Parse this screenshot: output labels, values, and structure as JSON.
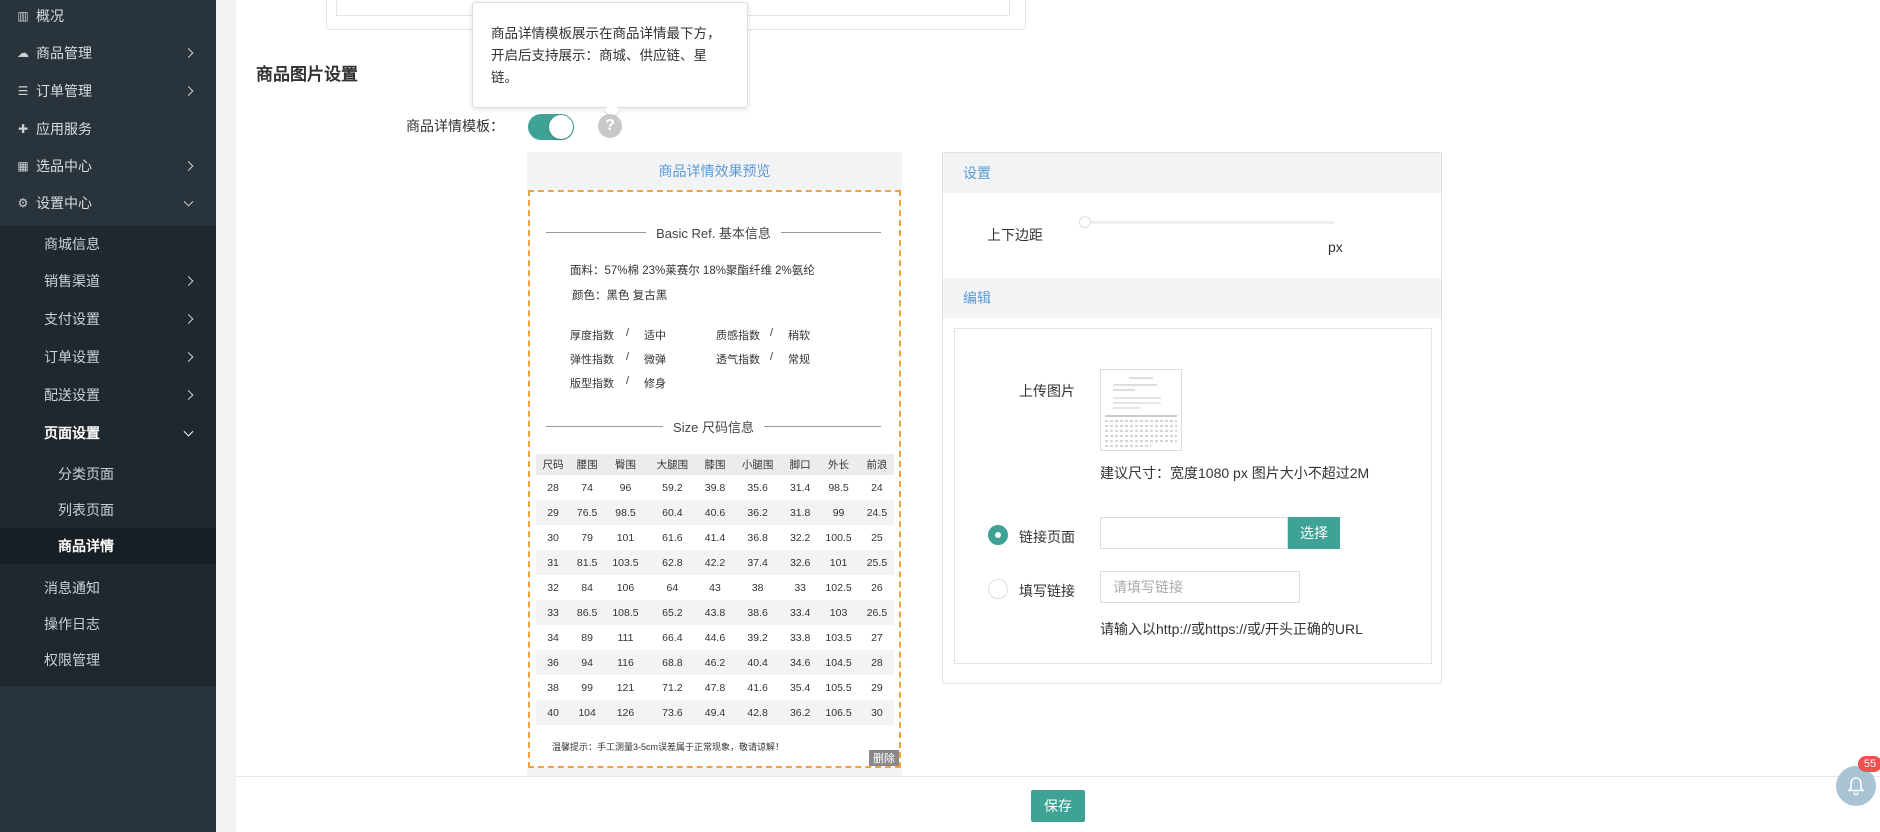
{
  "sidebar": {
    "items": [
      {
        "label": "概况",
        "icon": "book-icon"
      },
      {
        "label": "商品管理",
        "icon": "cloud-icon"
      },
      {
        "label": "订单管理",
        "icon": "list-icon"
      },
      {
        "label": "应用服务",
        "icon": "puzzle-icon"
      },
      {
        "label": "选品中心",
        "icon": "table-icon"
      },
      {
        "label": "设置中心",
        "icon": "gear-icon"
      }
    ],
    "sub_items": [
      "商城信息",
      "销售渠道",
      "支付设置",
      "订单设置",
      "配送设置",
      "页面设置",
      "消息通知",
      "操作日志",
      "权限管理"
    ],
    "page_sub_items": [
      "分类页面",
      "列表页面",
      "商品详情"
    ]
  },
  "section_title": "商品图片设置",
  "tooltip_text": "商品详情模板展示在商品详情最下方，开启后支持展示：商城、供应链、星链。",
  "template_label": "商品详情模板：",
  "template_enabled": true,
  "help_glyph": "?",
  "preview": {
    "header": "商品详情效果预览",
    "basic_title": "Basic Ref.  基本信息",
    "fabric": "面料：57%棉 23%莱赛尔 18%聚酯纤维 2%氨纶",
    "color": "颜色：黑色 复古黑",
    "indices": [
      {
        "name": "厚度指数",
        "value": "适中"
      },
      {
        "name": "质感指数",
        "value": "稍软"
      },
      {
        "name": "弹性指数",
        "value": "微弹"
      },
      {
        "name": "透气指数",
        "value": "常规"
      },
      {
        "name": "版型指数",
        "value": "修身"
      }
    ],
    "separator": "/",
    "size_title": "Size  尺码信息",
    "size_headers": [
      "尺码",
      "腰围",
      "臀围",
      "大腿围",
      "膝围",
      "小腿围",
      "脚口",
      "外长",
      "前浪"
    ],
    "size_rows": [
      [
        "28",
        "74",
        "96",
        "59.2",
        "39.8",
        "35.6",
        "31.4",
        "98.5",
        "24"
      ],
      [
        "29",
        "76.5",
        "98.5",
        "60.4",
        "40.6",
        "36.2",
        "31.8",
        "99",
        "24.5"
      ],
      [
        "30",
        "79",
        "101",
        "61.6",
        "41.4",
        "36.8",
        "32.2",
        "100.5",
        "25"
      ],
      [
        "31",
        "81.5",
        "103.5",
        "62.8",
        "42.2",
        "37.4",
        "32.6",
        "101",
        "25.5"
      ],
      [
        "32",
        "84",
        "106",
        "64",
        "43",
        "38",
        "33",
        "102.5",
        "26"
      ],
      [
        "33",
        "86.5",
        "108.5",
        "65.2",
        "43.8",
        "38.6",
        "33.4",
        "103",
        "26.5"
      ],
      [
        "34",
        "89",
        "111",
        "66.4",
        "44.6",
        "39.2",
        "33.8",
        "103.5",
        "27"
      ],
      [
        "36",
        "94",
        "116",
        "68.8",
        "46.2",
        "40.4",
        "34.6",
        "104.5",
        "28"
      ],
      [
        "38",
        "99",
        "121",
        "71.2",
        "47.8",
        "41.6",
        "35.4",
        "105.5",
        "29"
      ],
      [
        "40",
        "104",
        "126",
        "73.6",
        "49.4",
        "42.8",
        "36.2",
        "106.5",
        "30"
      ]
    ],
    "note": "温馨提示：手工测量3-5cm误差属于正常现象，敬请谅解！",
    "delete_label": "删除"
  },
  "settings": {
    "header": "设置",
    "margin_label": "上下边距",
    "margin_unit": "px",
    "edit_header": "编辑",
    "upload_label": "上传图片",
    "size_hint": "建议尺寸：宽度1080 px 图片大小不超过2M",
    "link_page_label": "链接页面",
    "link_page_selected": true,
    "link_page_value": "",
    "choose_button": "选择",
    "custom_link_label": "填写链接",
    "custom_link_placeholder": "请填写链接",
    "url_hint": "请输入以http://或https://或/开头正确的URL"
  },
  "footer": {
    "save_button": "保存"
  },
  "notification_count": "55",
  "colors": {
    "accent": "#3ea394",
    "link": "#5b9bd5",
    "preview_border": "#f0a23c",
    "sidebar": "#29333b"
  }
}
